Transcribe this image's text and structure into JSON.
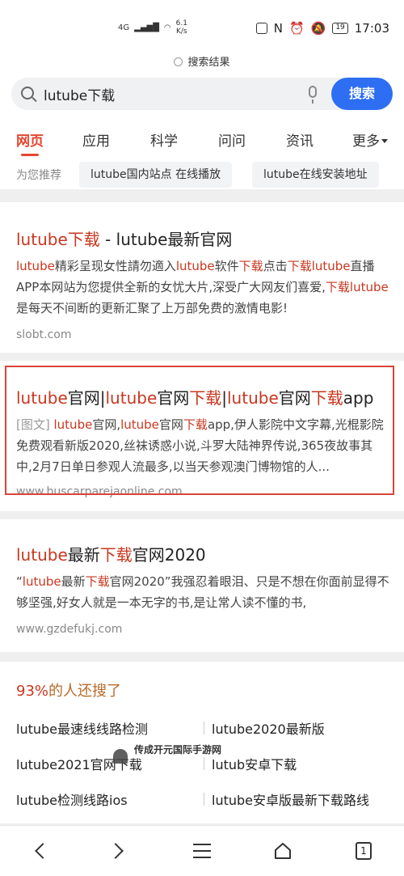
{
  "status": {
    "network": "4G",
    "speed": "6.1",
    "speed_unit": "K/s",
    "battery": "19",
    "time": "17:03"
  },
  "header": {
    "subtitle": "搜索结果",
    "query": "lutube下载",
    "search_button": "搜索"
  },
  "tabs": [
    {
      "label": "网页",
      "active": true
    },
    {
      "label": "应用"
    },
    {
      "label": "科学"
    },
    {
      "label": "问问"
    },
    {
      "label": "资讯"
    },
    {
      "label": "更多"
    }
  ],
  "recommend": {
    "label": "为您推荐",
    "chips": [
      "lutube国内站点 在线播放",
      "lutube在线安装地址"
    ]
  },
  "results": [
    {
      "title": "lutube下载 - lutube最新官网",
      "snippet": "lutube精彩呈现女性請勿適入lutube软件下载点击下载lutube直播APP本网站为您提供全新的女忧大片,深受广大网友们喜爱,下载lutube是每天不间断的更新汇聚了上万部免费的激情电影!",
      "url": "slobt.com"
    },
    {
      "title": "lutube官网|lutube官网下载|lutube官网下载app",
      "tag": "[图文]",
      "snippet": "lutube官网,lutube官网下载app,伊人影院中文字幕,光棍影院免费观看新版2020,丝袜诱惑小说,斗罗大陆神界传说,365夜故事其中,2月7日单日参观人流最多,以当天参观澳门博物馆的人...",
      "url": "www.buscarparejaonline.com"
    },
    {
      "title": "lutube最新下载官网2020",
      "snippet": "“lutube最新下载官网2020”我强忍着眼泪、只是不想在你面前显得不够坚强,好女人就是一本无字的书,是让常人读不懂的书,",
      "url": "www.gzdefukj.com"
    }
  ],
  "also_searched": {
    "percent": "93%",
    "label": "的人还搜了",
    "items": [
      "lutube最速线线路检测",
      "lutube2020最新版",
      "lutube2021官网下载",
      "lutub安卓下载",
      "lutube检测线路ios",
      "lutube安卓版最新下载路线"
    ]
  },
  "watermark": "传成开元国际手游网",
  "navbar": {
    "tab_count": "1"
  },
  "colors": {
    "accent": "#e6452f",
    "highlight": "#c8371f",
    "button": "#2d6ef2",
    "frame": "#d9443a"
  }
}
